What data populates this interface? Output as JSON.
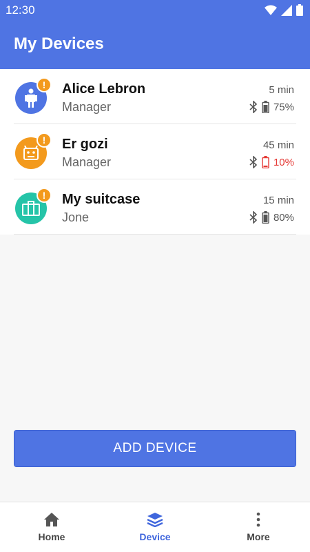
{
  "status_bar": {
    "time": "12:30",
    "icons": [
      "wifi-icon",
      "signal-icon",
      "battery-icon"
    ]
  },
  "app_bar": {
    "title": "My Devices"
  },
  "devices": [
    {
      "name": "Alice Lebron",
      "role": "Manager",
      "last_seen": "5 min",
      "battery": "75%",
      "battery_level": 0.75,
      "battery_low": false,
      "avatar_icon": "person-icon",
      "avatar_color": "#4f74e3"
    },
    {
      "name": "Er gozi",
      "role": "Manager",
      "last_seen": "45 min",
      "battery": "10%",
      "battery_level": 0.1,
      "battery_low": true,
      "avatar_icon": "robot-icon",
      "avatar_color": "#f39a1d"
    },
    {
      "name": "My suitcase",
      "role": "Jone",
      "last_seen": "15 min",
      "battery": "80%",
      "battery_level": 0.8,
      "battery_low": false,
      "avatar_icon": "suitcase-icon",
      "avatar_color": "#25c4a8"
    }
  ],
  "add_button": {
    "label": "ADD DEVICE"
  },
  "bottom_nav": [
    {
      "label": "Home",
      "icon": "home-icon",
      "active": false
    },
    {
      "label": "Device",
      "icon": "layers-icon",
      "active": true
    },
    {
      "label": "More",
      "icon": "more-vert-icon",
      "active": false
    }
  ],
  "colors": {
    "primary": "#4f74e3",
    "alert": "#f39a1d",
    "battery_low": "#e53935"
  }
}
